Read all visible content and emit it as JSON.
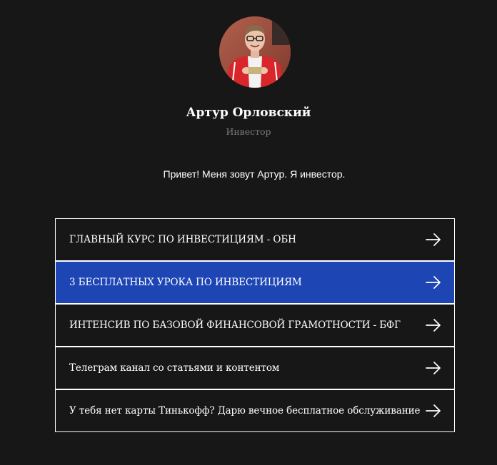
{
  "profile": {
    "name": "Артур Орловский",
    "role": "Инвестор",
    "bio": "Привет! Меня зовут Артур. Я инвестор.",
    "avatar_icon": "profile-photo"
  },
  "links": [
    {
      "label": "ГЛАВНЫЙ КУРС ПО ИНВЕСТИЦИЯМ - ОБН",
      "icon": "arrow-right-icon",
      "active": false
    },
    {
      "label": "3 БЕСПЛАТНЫХ УРОКА ПО ИНВЕСТИЦИЯМ",
      "icon": "arrow-right-icon",
      "active": true
    },
    {
      "label": "ИНТЕНСИВ ПО БАЗОВОЙ ФИНАНСОВОЙ ГРАМОТНОСТИ - БФГ",
      "icon": "arrow-right-icon",
      "active": false
    },
    {
      "label": "Телеграм канал со статьями и контентом",
      "icon": "arrow-right-icon",
      "active": false
    },
    {
      "label": "У тебя нет карты Тинькофф? Дарю вечное бесплатное обслуживание",
      "icon": "arrow-right-icon",
      "active": false
    }
  ],
  "colors": {
    "background": "#171717",
    "active_link": "#1e45b4",
    "text": "#ffffff",
    "muted": "#7b7b7b"
  }
}
